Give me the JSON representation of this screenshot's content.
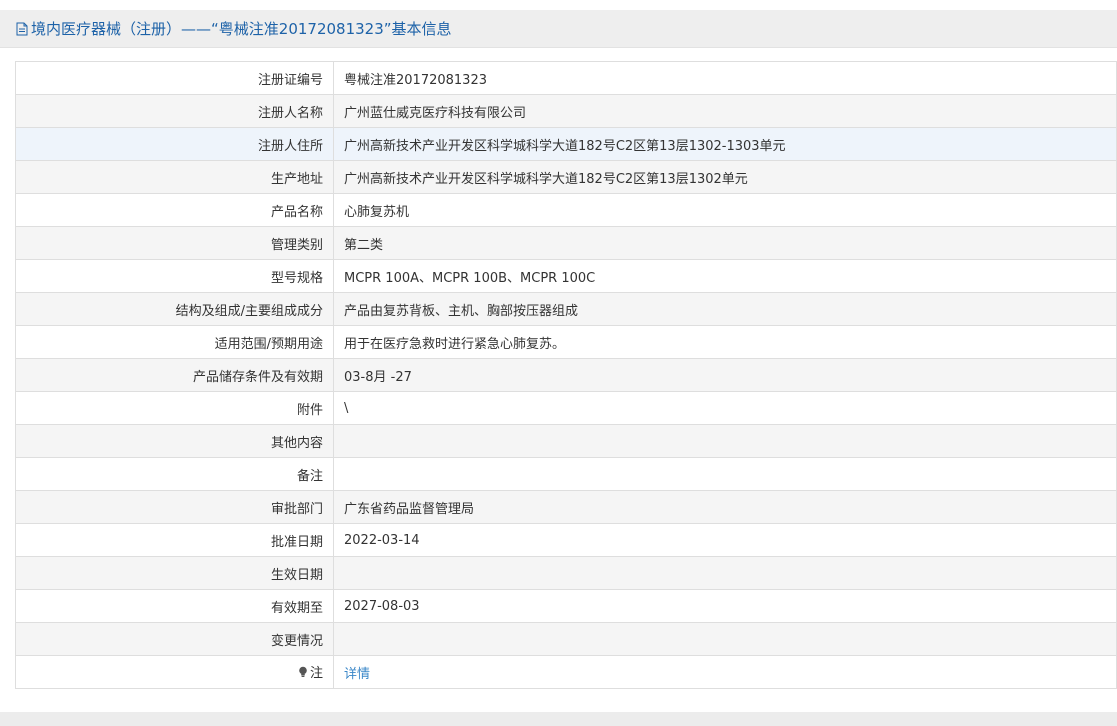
{
  "header": {
    "title": "境内医疗器械（注册）——“粤械注准20172081323”基本信息",
    "icon": "document-icon"
  },
  "rows": [
    {
      "label": "注册证编号",
      "value": "粤械注准20172081323"
    },
    {
      "label": "注册人名称",
      "value": "广州蓝仕威克医疗科技有限公司"
    },
    {
      "label": "注册人住所",
      "value": "广州高新技术产业开发区科学城科学大道182号C2区第13层1302-1303单元"
    },
    {
      "label": "生产地址",
      "value": "广州高新技术产业开发区科学城科学大道182号C2区第13层1302单元"
    },
    {
      "label": "产品名称",
      "value": "心肺复苏机"
    },
    {
      "label": "管理类别",
      "value": "第二类"
    },
    {
      "label": "型号规格",
      "value": "MCPR 100A、MCPR 100B、MCPR 100C"
    },
    {
      "label": "结构及组成/主要组成成分",
      "value": "产品由复苏背板、主机、胸部按压器组成"
    },
    {
      "label": "适用范围/预期用途",
      "value": "用于在医疗急救时进行紧急心肺复苏。"
    },
    {
      "label": "产品储存条件及有效期",
      "value": "03-8月 -27"
    },
    {
      "label": "附件",
      "value": "\\"
    },
    {
      "label": "其他内容",
      "value": ""
    },
    {
      "label": "备注",
      "value": ""
    },
    {
      "label": "审批部门",
      "value": "广东省药品监督管理局"
    },
    {
      "label": "批准日期",
      "value": "2022-03-14"
    },
    {
      "label": "生效日期",
      "value": ""
    },
    {
      "label": "有效期至",
      "value": "2027-08-03"
    },
    {
      "label": "变更情况",
      "value": ""
    }
  ],
  "note": {
    "label": "注",
    "link": "详情",
    "icon": "lightbulb-icon"
  },
  "colors": {
    "title": "#1d62a8",
    "link": "#3a87c8",
    "stripe": "#f5f5f5",
    "highlight": "#eef4fb",
    "border": "#dedede"
  }
}
